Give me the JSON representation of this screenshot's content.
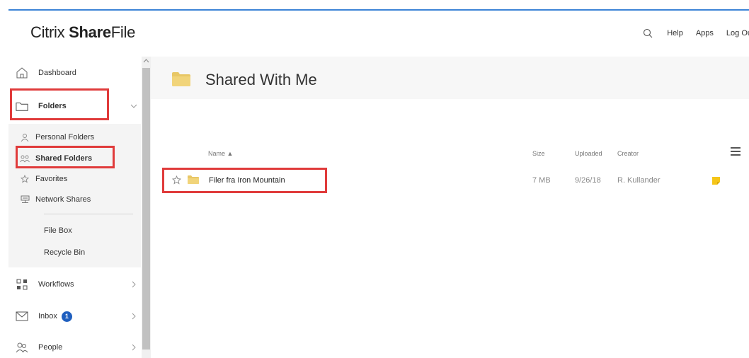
{
  "app": {
    "logo_pre": "Citrix ",
    "logo_bold": "Share",
    "logo_post": "File",
    "accent_color": "#3d84d6",
    "highlight_color": "#e03b3b"
  },
  "topnav": {
    "search_icon": "search-icon",
    "help": "Help",
    "apps": "Apps",
    "logout": "Log Ou"
  },
  "sidebar": {
    "dashboard": "Dashboard",
    "folders": "Folders",
    "workflows": "Workflows",
    "inbox": "Inbox",
    "inbox_count": "1",
    "people": "People"
  },
  "folders_sub": {
    "personal": "Personal Folders",
    "shared": "Shared Folders",
    "favorites": "Favorites",
    "network": "Network Shares",
    "filebox": "File Box",
    "recycle": "Recycle Bin"
  },
  "main": {
    "title": "Shared With Me",
    "columns": {
      "name": "Name ▲",
      "size": "Size",
      "uploaded": "Uploaded",
      "creator": "Creator"
    },
    "rows": [
      {
        "name": "Filer fra Iron Mountain",
        "size": "7 MB",
        "uploaded": "9/26/18",
        "creator": "R. Kullander"
      }
    ]
  }
}
